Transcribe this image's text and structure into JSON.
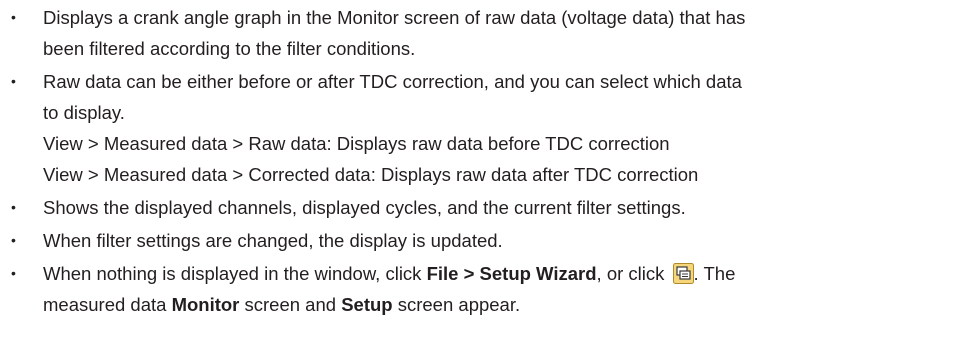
{
  "bullet_symbol": "•",
  "items": [
    {
      "lines": [
        "Displays a crank angle graph in the Monitor screen of raw data (voltage data) that has",
        "been filtered according to the filter conditions."
      ]
    },
    {
      "lines": [
        "Raw data can be either before or after TDC correction, and you can select which data",
        "to display.",
        "View > Measured data > Raw data: Displays raw data before TDC correction",
        "View > Measured data > Corrected data: Displays raw data after TDC correction"
      ]
    },
    {
      "lines": [
        "Shows the displayed channels, displayed cycles, and the current filter settings."
      ]
    },
    {
      "lines": [
        "When filter settings are changed, the display is updated."
      ]
    },
    {
      "line1": {
        "before": "When nothing is displayed in the window, click ",
        "bold1": "File > Setup Wizard",
        "middle": ", or click ",
        "after": ". The"
      },
      "line2": {
        "before": "measured data ",
        "bold1": "Monitor",
        "middle": " screen and ",
        "bold2": "Setup",
        "after": " screen appear."
      },
      "icon": "setup-wizard-icon"
    }
  ],
  "colors": {
    "text": "#231f20",
    "icon_bg": "#f5d67a",
    "icon_border": "#b08a2a",
    "icon_dark": "#3a3a3a"
  }
}
